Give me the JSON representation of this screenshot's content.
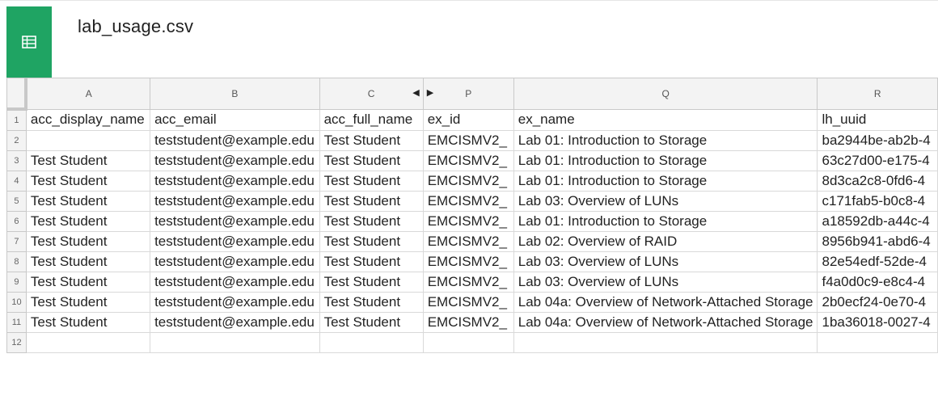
{
  "file": {
    "name": "lab_usage.csv",
    "icon": "spreadsheet-icon",
    "accent": "#1fa463"
  },
  "columns": [
    {
      "letter": "A",
      "header": "acc_display_name"
    },
    {
      "letter": "B",
      "header": "acc_email"
    },
    {
      "letter": "C",
      "header": "acc_full_name"
    },
    {
      "letter": "P",
      "header": "ex_id"
    },
    {
      "letter": "Q",
      "header": "ex_name"
    },
    {
      "letter": "R",
      "header": "lh_uuid"
    }
  ],
  "hidden_markers": {
    "left": "◀",
    "right": "▶"
  },
  "rows": [
    {
      "num": "1",
      "cells": [
        "acc_display_name",
        "acc_email",
        "acc_full_name",
        "ex_id",
        "ex_name",
        "lh_uuid"
      ]
    },
    {
      "num": "2",
      "cells": [
        "",
        "teststudent@example.edu",
        "Test Student",
        "EMCISMV2_",
        "Lab 01: Introduction to Storage",
        "ba2944be-ab2b-4"
      ]
    },
    {
      "num": "3",
      "cells": [
        "Test Student",
        "teststudent@example.edu",
        "Test Student",
        "EMCISMV2_",
        "Lab 01: Introduction to Storage",
        "63c27d00-e175-4"
      ]
    },
    {
      "num": "4",
      "cells": [
        "Test Student",
        "teststudent@example.edu",
        "Test Student",
        "EMCISMV2_",
        "Lab 01: Introduction to Storage",
        "8d3ca2c8-0fd6-4"
      ]
    },
    {
      "num": "5",
      "cells": [
        "Test Student",
        "teststudent@example.edu",
        "Test Student",
        "EMCISMV2_",
        "Lab 03: Overview of LUNs",
        "c171fab5-b0c8-4"
      ]
    },
    {
      "num": "6",
      "cells": [
        "Test Student",
        "teststudent@example.edu",
        "Test Student",
        "EMCISMV2_",
        "Lab 01: Introduction to Storage",
        "a18592db-a44c-4"
      ]
    },
    {
      "num": "7",
      "cells": [
        "Test Student",
        "teststudent@example.edu",
        "Test Student",
        "EMCISMV2_",
        "Lab 02: Overview of RAID",
        "8956b941-abd6-4"
      ]
    },
    {
      "num": "8",
      "cells": [
        "Test Student",
        "teststudent@example.edu",
        "Test Student",
        "EMCISMV2_",
        "Lab 03: Overview of LUNs",
        "82e54edf-52de-4"
      ]
    },
    {
      "num": "9",
      "cells": [
        "Test Student",
        "teststudent@example.edu",
        "Test Student",
        "EMCISMV2_",
        "Lab 03: Overview of LUNs",
        "f4a0d0c9-e8c4-4"
      ]
    },
    {
      "num": "10",
      "cells": [
        "Test Student",
        "teststudent@example.edu",
        "Test Student",
        "EMCISMV2_",
        "Lab 04a: Overview of Network-Attached Storage",
        "2b0ecf24-0e70-4"
      ]
    },
    {
      "num": "11",
      "cells": [
        "Test Student",
        "teststudent@example.edu",
        "Test Student",
        "EMCISMV2_",
        "Lab 04a: Overview of Network-Attached Storage",
        "1ba36018-0027-4"
      ]
    },
    {
      "num": "12",
      "cells": [
        "",
        "",
        "",
        "",
        "",
        ""
      ]
    }
  ]
}
